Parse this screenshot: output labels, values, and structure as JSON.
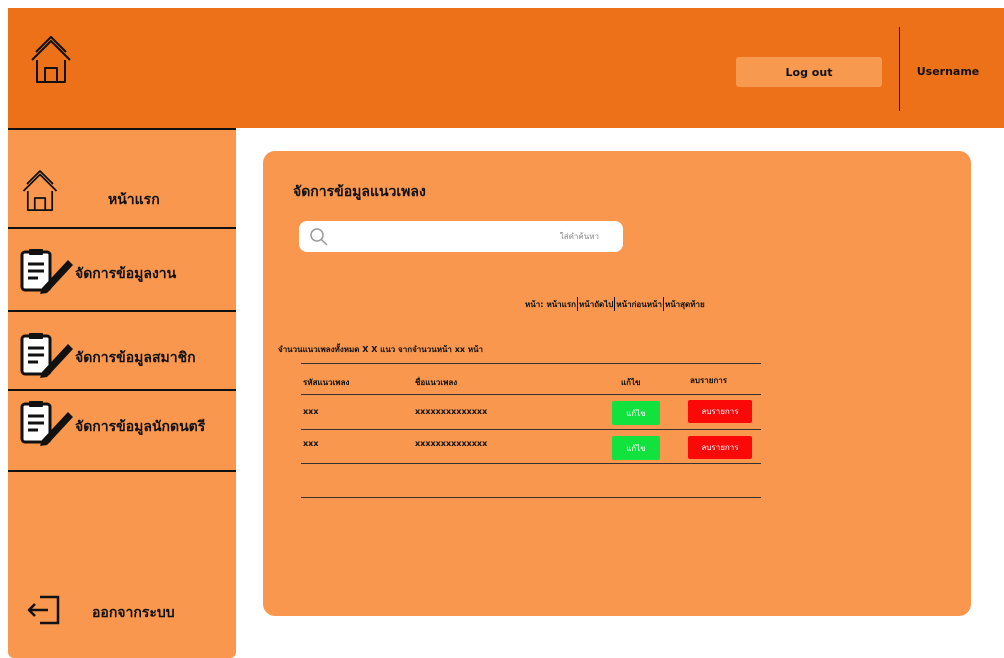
{
  "header": {
    "logout_label": "Log out",
    "username": "Username"
  },
  "sidebar": {
    "items": [
      {
        "label": "หน้าแรก",
        "icon": "home-icon"
      },
      {
        "label": "จัดการข้อมูลงาน",
        "icon": "edit-document-icon"
      },
      {
        "label": "จัดการข้อมูลสมาชิก",
        "icon": "edit-document-icon"
      },
      {
        "label": "จัดการข้อมูลนักดนตรี",
        "icon": "edit-document-icon"
      }
    ],
    "logout_label": "ออกจากระบบ"
  },
  "main": {
    "title": "จัดการข้อมูลแนวเพลง",
    "search": {
      "placeholder": "ใส่คำค้นหา",
      "value": ""
    },
    "pager": {
      "prefix": "หน้า:",
      "first": "หน้าแรก",
      "next": "หน้าถัดไป",
      "prev": "หน้าก่อนหน้า",
      "last": "หน้าสุดท้าย"
    },
    "summary": "จำนวนแนวเพลงทั้งหมด X X แนว จากจำนวนหน้า xx หน้า",
    "table": {
      "headers": [
        "รหัสแนวเพลง",
        "ชื่อแนวเพลง",
        "แก้ไข",
        "ลบรายการ"
      ],
      "rows": [
        {
          "id": "xxx",
          "name": "xxxxxxxxxxxxxx",
          "edit": "แก้ไข",
          "delete": "ลบรายการ"
        },
        {
          "id": "xxx",
          "name": "xxxxxxxxxxxxxx",
          "edit": "แก้ไข",
          "delete": "ลบรายการ"
        }
      ]
    }
  },
  "colors": {
    "header": "#EC7118",
    "panel": "#F8974D",
    "edit": "#12E23E",
    "delete": "#FB0808"
  }
}
